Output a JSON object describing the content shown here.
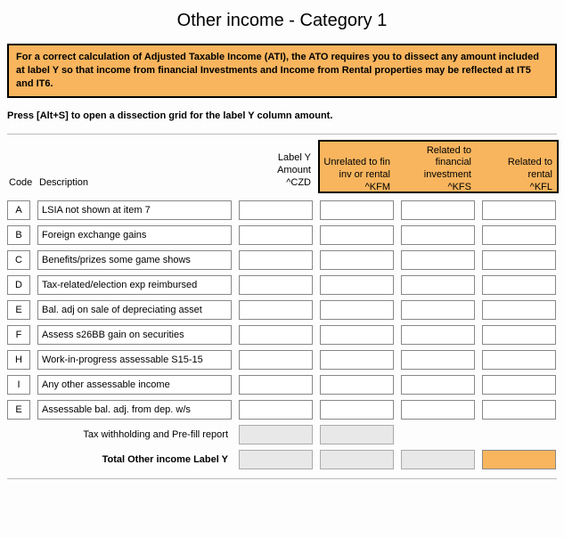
{
  "title": "Other income - Category 1",
  "warning": "For a correct calculation of Adjusted Taxable Income (ATI), the ATO requires you to dissect any amount included at label Y so that income from financial Investments and Income from Rental properties may be reflected at IT5 and IT6.",
  "instruction": "Press [Alt+S] to open a dissection grid for the label Y column amount.",
  "headers": {
    "code": "Code",
    "description": "Description",
    "labelY": {
      "l1": "Label Y",
      "l2": "Amount",
      "l3": "^CZD"
    },
    "unrelated": {
      "l1": "Unrelated to fin",
      "l2": "inv or rental",
      "l3": "^KFM"
    },
    "related_fin": {
      "l1": "Related to",
      "l2": "financial",
      "l3": "investment",
      "l4": "^KFS"
    },
    "related_rental": {
      "l1": "Related to",
      "l2": "rental",
      "l3": "^KFL"
    }
  },
  "rows": [
    {
      "code": "A",
      "desc": "LSIA not shown at item 7"
    },
    {
      "code": "B",
      "desc": "Foreign exchange gains"
    },
    {
      "code": "C",
      "desc": "Benefits/prizes some game shows"
    },
    {
      "code": "D",
      "desc": "Tax-related/election exp reimbursed"
    },
    {
      "code": "E",
      "desc": "Bal. adj on sale of depreciating asset"
    },
    {
      "code": "F",
      "desc": "Assess s26BB gain on securities"
    },
    {
      "code": "H",
      "desc": "Work-in-progress assessable S15-15"
    },
    {
      "code": "I",
      "desc": "Any other assessable income"
    },
    {
      "code": "E",
      "desc": "Assessable bal. adj. from dep. w/s"
    }
  ],
  "footer": {
    "tax_withholding": "Tax withholding and Pre-fill report",
    "total": "Total Other income Label Y"
  }
}
